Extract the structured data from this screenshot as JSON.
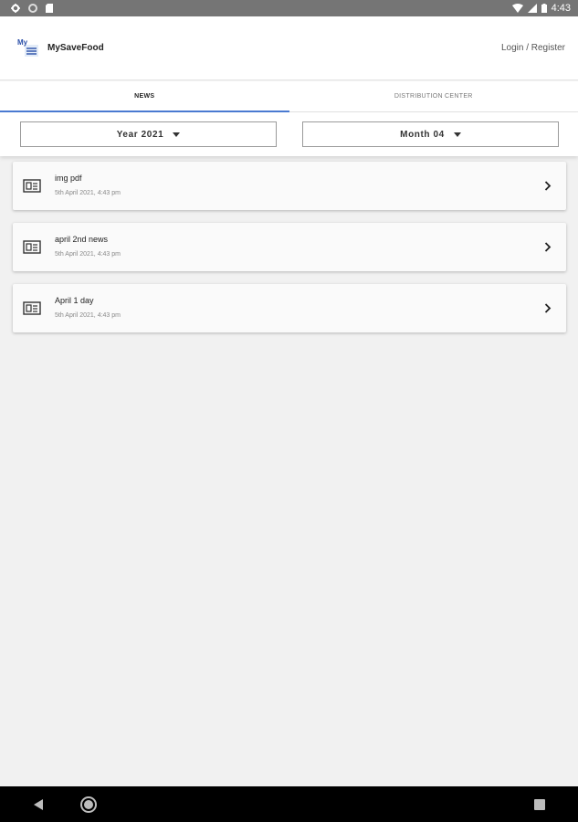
{
  "status_bar": {
    "time": "4:43",
    "icons": [
      "gear-icon",
      "circle-icon",
      "sd-card-icon",
      "wifi-icon",
      "signal-icon",
      "battery-icon"
    ]
  },
  "header": {
    "app_name": "MySaveFood",
    "login_label": "Login / Register",
    "logo_text": "My"
  },
  "tabs": [
    {
      "label": "NEWS",
      "active": true
    },
    {
      "label": "DISTRIBUTION CENTER",
      "active": false
    }
  ],
  "filters": {
    "year_label": "Year 2021",
    "month_label": "Month 04"
  },
  "news": [
    {
      "title": "img pdf",
      "date": "5th April 2021, 4:43 pm"
    },
    {
      "title": "april 2nd news",
      "date": "5th April 2021, 4:43 pm"
    },
    {
      "title": "April 1 day",
      "date": "5th April 2021, 4:43 pm"
    }
  ],
  "colors": {
    "status_bar": "#757575",
    "accent": "#4b7bd3",
    "background": "#f1f1f1",
    "nav_bar": "#000000"
  },
  "nav_bar": {
    "icons": [
      "back-icon",
      "home-icon",
      "recents-icon"
    ]
  }
}
